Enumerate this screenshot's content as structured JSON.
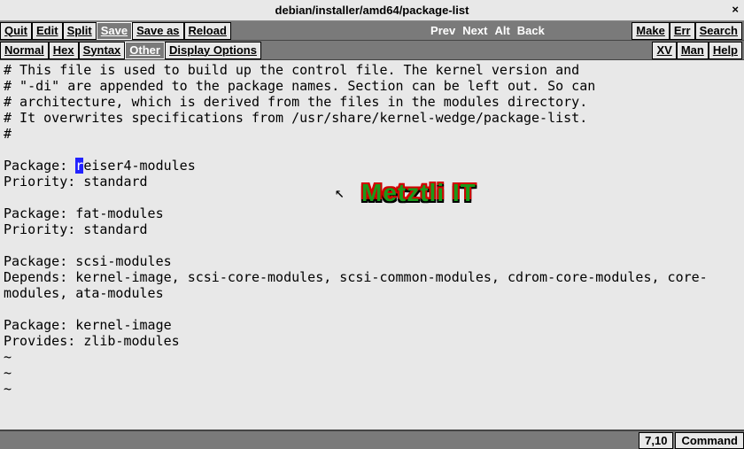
{
  "titlebar": {
    "title": "debian/installer/amd64/package-list",
    "close": "×"
  },
  "toolbar1": {
    "quit": "Quit",
    "edit": "Edit",
    "split": "Split",
    "save": "Save",
    "saveas": "Save as",
    "reload": "Reload",
    "prev": "Prev",
    "next": "Next",
    "alt": "Alt",
    "back": "Back",
    "make": "Make",
    "err": "Err",
    "search": "Search"
  },
  "toolbar2": {
    "normal": "Normal",
    "hex": "Hex",
    "syntax": "Syntax",
    "other": "Other",
    "display_options": "Display Options",
    "xv": "XV",
    "man": "Man",
    "help": "Help"
  },
  "editor": {
    "lines": [
      "# This file is used to build up the control file. The kernel version and",
      "# \"-di\" are appended to the package names. Section can be left out. So can",
      "# architecture, which is derived from the files in the modules directory.",
      "# It overwrites specifications from /usr/share/kernel-wedge/package-list.",
      "#",
      "",
      "Package: reiser4-modules",
      "Priority: standard",
      "",
      "Package: fat-modules",
      "Priority: standard",
      "",
      "Package: scsi-modules",
      "Depends: kernel-image, scsi-core-modules, scsi-common-modules, cdrom-core-modules, core-modules, ata-modules",
      "",
      "Package: kernel-image",
      "Provides: zlib-modules"
    ],
    "cursor": {
      "line": 6,
      "col": 9
    },
    "tildes": [
      "~",
      "~",
      "~"
    ]
  },
  "watermark": "Metztli IT",
  "status": {
    "position": "7,10",
    "mode": "Command"
  }
}
